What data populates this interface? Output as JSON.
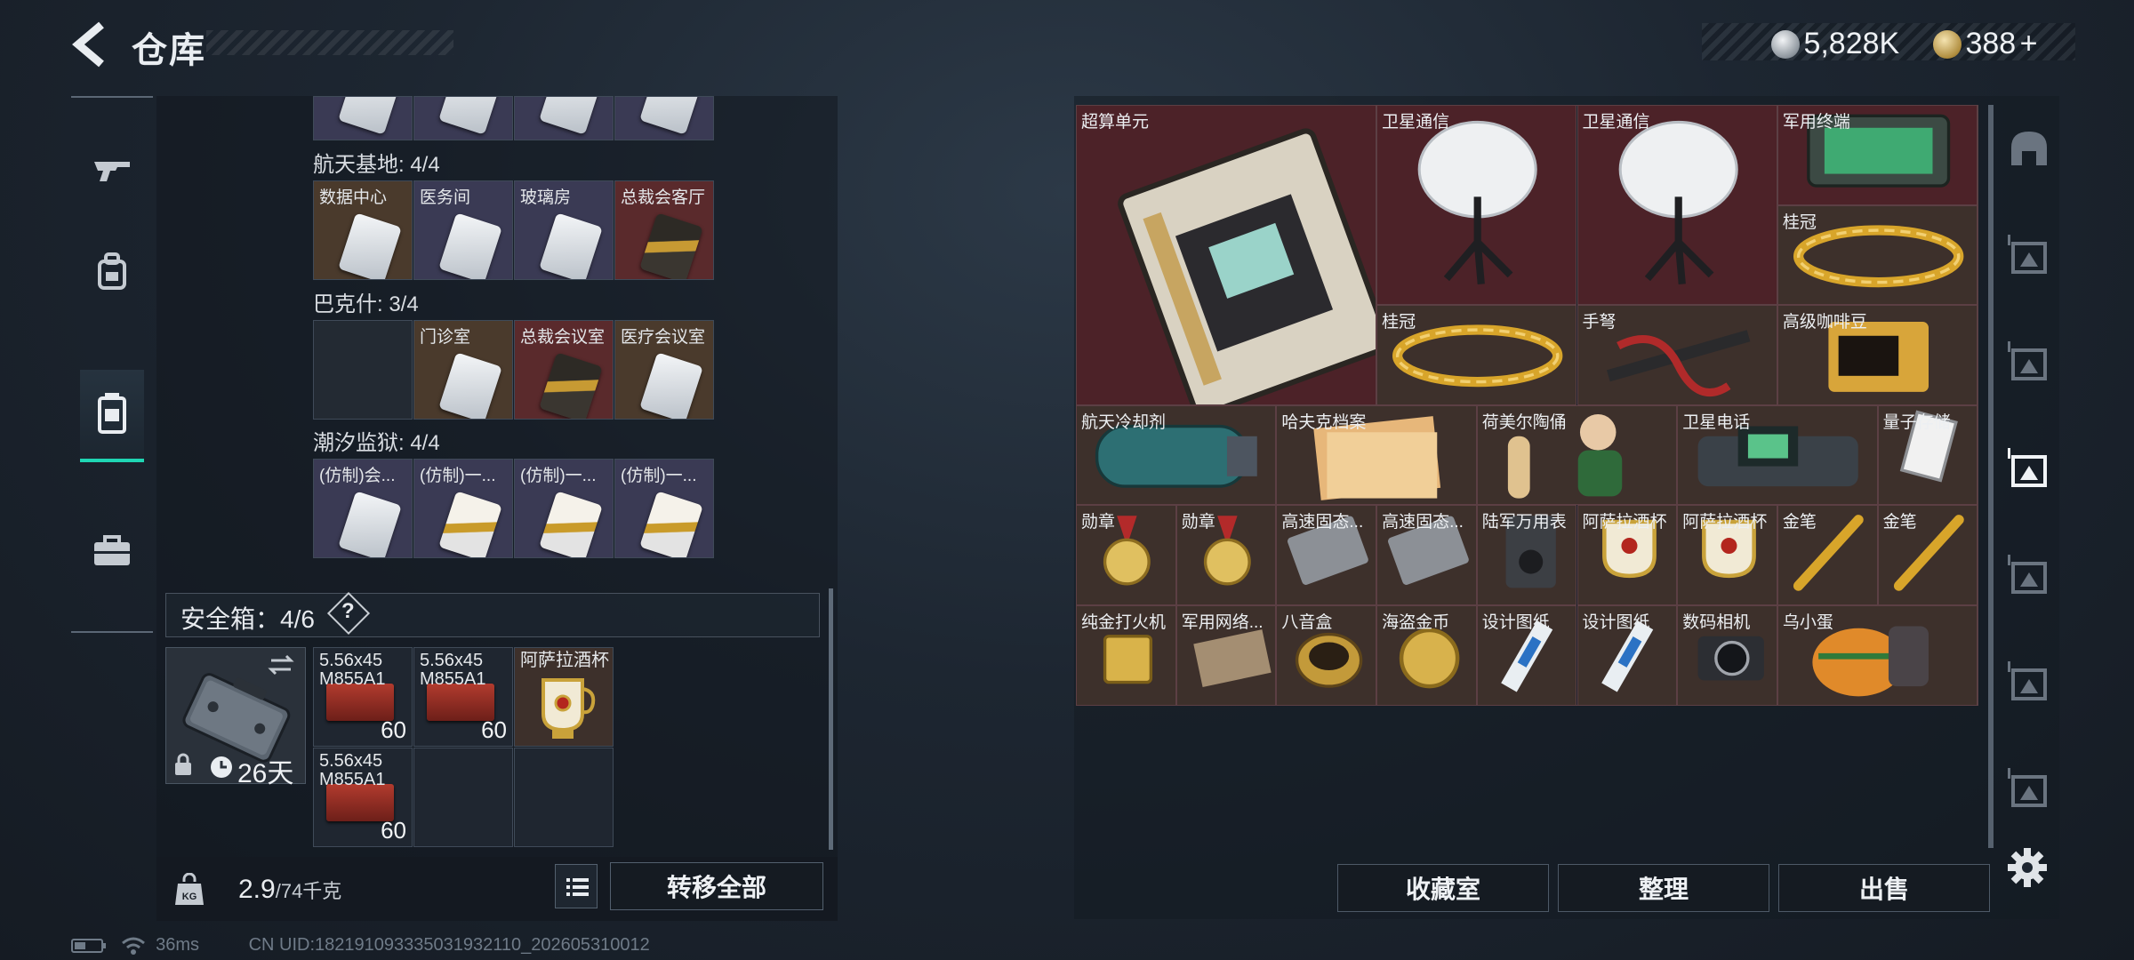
{
  "header": {
    "title": "仓库",
    "coins_label": "5,828K",
    "tokens_label": "388",
    "plus": "+"
  },
  "left_nav": {
    "tabs": [
      {
        "icon": "rifle-icon"
      },
      {
        "icon": "backpack-icon"
      },
      {
        "icon": "vest-icon"
      },
      {
        "icon": "briefcase-icon"
      }
    ],
    "active_index": 2
  },
  "keycards": {
    "sections": [
      {
        "label": "航天基地: 4/4",
        "items": [
          {
            "name": "数据中心",
            "style": "brown",
            "card": "silver"
          },
          {
            "name": "医务间",
            "style": "purple",
            "card": "silver"
          },
          {
            "name": "玻璃房",
            "style": "purple",
            "card": "silver"
          },
          {
            "name": "总裁会客厅",
            "style": "red",
            "card": "dark"
          }
        ]
      },
      {
        "label": "巴克什: 3/4",
        "items": [
          {
            "name": "",
            "style": "dark",
            "card": "none"
          },
          {
            "name": "门诊室",
            "style": "brown",
            "card": "silver"
          },
          {
            "name": "总裁会议室",
            "style": "red",
            "card": "dark"
          },
          {
            "name": "医疗会议室",
            "style": "brown",
            "card": "silver"
          }
        ]
      },
      {
        "label": "潮汐监狱: 4/4",
        "items": [
          {
            "name": "(仿制)会...",
            "style": "purple",
            "card": "silver"
          },
          {
            "name": "(仿制)一...",
            "style": "purple",
            "card": "gold"
          },
          {
            "name": "(仿制)一...",
            "style": "purple",
            "card": "gold"
          },
          {
            "name": "(仿制)一...",
            "style": "purple",
            "card": "gold"
          }
        ]
      }
    ]
  },
  "safe_box": {
    "label": "安全箱：4/6",
    "help": "?",
    "duration": "26天",
    "items": [
      {
        "name": "5.56x45\nM855A1",
        "count": "60"
      },
      {
        "name": "5.56x45\nM855A1",
        "count": "60"
      },
      {
        "name": "阿萨拉酒杯",
        "count": ""
      },
      {
        "name": "5.56x45\nM855A1",
        "count": "60"
      }
    ]
  },
  "footer_left": {
    "weight_current": "2.9",
    "weight_max": "/74千克",
    "transfer_all": "转移全部"
  },
  "status": {
    "ping": "36ms",
    "uid": "CN UID:18219109333503193​2110_202605310012"
  },
  "stash": {
    "items": [
      {
        "name": "超算单元",
        "col": 0,
        "row": 0,
        "w": 3,
        "h": 3,
        "bg": "red",
        "icon": "supercomputer-icon"
      },
      {
        "name": "卫星通信",
        "col": 3,
        "row": 0,
        "w": 2,
        "h": 2,
        "bg": "red",
        "icon": "satellite-dish-icon"
      },
      {
        "name": "卫星通信",
        "col": 5,
        "row": 0,
        "w": 2,
        "h": 2,
        "bg": "red",
        "icon": "satellite-dish-icon"
      },
      {
        "name": "军用终端",
        "col": 7,
        "row": 0,
        "w": 2,
        "h": 1,
        "bg": "red",
        "icon": "military-terminal-icon"
      },
      {
        "name": "桂冠",
        "col": 7,
        "row": 1,
        "w": 2,
        "h": 1,
        "bg": "tan",
        "icon": "laurel-crown-icon"
      },
      {
        "name": "桂冠",
        "col": 3,
        "row": 2,
        "w": 2,
        "h": 1,
        "bg": "tan",
        "icon": "laurel-crown-icon"
      },
      {
        "name": "手弩",
        "col": 5,
        "row": 2,
        "w": 2,
        "h": 1,
        "bg": "tan",
        "icon": "crossbow-icon"
      },
      {
        "name": "高级咖啡豆",
        "col": 7,
        "row": 2,
        "w": 2,
        "h": 1,
        "bg": "tan",
        "icon": "coffee-bag-icon"
      },
      {
        "name": "航天冷却剂",
        "col": 0,
        "row": 3,
        "w": 2,
        "h": 1,
        "bg": "tan",
        "icon": "coolant-tank-icon"
      },
      {
        "name": "哈夫克档案",
        "col": 2,
        "row": 3,
        "w": 2,
        "h": 1,
        "bg": "tan",
        "icon": "folder-icon"
      },
      {
        "name": "荷美尔陶俑",
        "col": 4,
        "row": 3,
        "w": 2,
        "h": 1,
        "bg": "tan",
        "icon": "figurine-icon"
      },
      {
        "name": "卫星电话",
        "col": 6,
        "row": 3,
        "w": 2,
        "h": 1,
        "bg": "tan",
        "icon": "satellite-phone-icon"
      },
      {
        "name": "量子存储",
        "col": 8,
        "row": 3,
        "w": 1,
        "h": 1,
        "bg": "tan",
        "icon": "quantum-drive-icon"
      },
      {
        "name": "勋章",
        "col": 0,
        "row": 4,
        "w": 1,
        "h": 1,
        "bg": "tan",
        "icon": "medal-icon"
      },
      {
        "name": "勋章",
        "col": 1,
        "row": 4,
        "w": 1,
        "h": 1,
        "bg": "tan",
        "icon": "medal-icon"
      },
      {
        "name": "高速固态...",
        "col": 2,
        "row": 4,
        "w": 1,
        "h": 1,
        "bg": "tan",
        "icon": "ssd-icon"
      },
      {
        "name": "高速固态...",
        "col": 3,
        "row": 4,
        "w": 1,
        "h": 1,
        "bg": "tan",
        "icon": "ssd-icon"
      },
      {
        "name": "陆军万用表",
        "col": 4,
        "row": 4,
        "w": 1,
        "h": 1,
        "bg": "tan",
        "icon": "multimeter-icon"
      },
      {
        "name": "阿萨拉酒杯",
        "col": 5,
        "row": 4,
        "w": 1,
        "h": 1,
        "bg": "tan",
        "icon": "goblet-icon"
      },
      {
        "name": "阿萨拉酒杯",
        "col": 6,
        "row": 4,
        "w": 1,
        "h": 1,
        "bg": "tan",
        "icon": "goblet-icon"
      },
      {
        "name": "金笔",
        "col": 7,
        "row": 4,
        "w": 1,
        "h": 1,
        "bg": "tan",
        "icon": "gold-pen-icon"
      },
      {
        "name": "金笔",
        "col": 8,
        "row": 4,
        "w": 1,
        "h": 1,
        "bg": "tan",
        "icon": "gold-pen-icon"
      },
      {
        "name": "纯金打火机",
        "col": 0,
        "row": 5,
        "w": 1,
        "h": 1,
        "bg": "tan",
        "icon": "lighter-icon"
      },
      {
        "name": "军用网络...",
        "col": 1,
        "row": 5,
        "w": 1,
        "h": 1,
        "bg": "tan",
        "icon": "network-device-icon"
      },
      {
        "name": "八音盒",
        "col": 2,
        "row": 5,
        "w": 1,
        "h": 1,
        "bg": "tan",
        "icon": "music-box-icon"
      },
      {
        "name": "海盗金币",
        "col": 3,
        "row": 5,
        "w": 1,
        "h": 1,
        "bg": "tan",
        "icon": "gold-coin-icon"
      },
      {
        "name": "设计图纸",
        "col": 4,
        "row": 5,
        "w": 1,
        "h": 1,
        "bg": "tan",
        "icon": "blueprint-icon"
      },
      {
        "name": "设计图纸",
        "col": 5,
        "row": 5,
        "w": 1,
        "h": 1,
        "bg": "tan",
        "icon": "blueprint-icon"
      },
      {
        "name": "数码相机",
        "col": 6,
        "row": 5,
        "w": 1,
        "h": 1,
        "bg": "tan",
        "icon": "camera-icon"
      },
      {
        "name": "乌小蛋",
        "col": 7,
        "row": 5,
        "w": 2,
        "h": 1,
        "bg": "tan",
        "icon": "egg-toy-icon"
      }
    ]
  },
  "actions": {
    "collection": "收藏室",
    "sort": "整理",
    "sell": "出售"
  },
  "right_nav": {
    "tabs": [
      {
        "icon": "helmet-icon"
      },
      {
        "icon": "stash-tab-2-icon"
      },
      {
        "icon": "stash-tab-3-icon"
      },
      {
        "icon": "stash-tab-4-icon"
      },
      {
        "icon": "stash-tab-5-icon"
      },
      {
        "icon": "stash-tab-6-icon"
      },
      {
        "icon": "stash-tab-7-icon"
      }
    ],
    "active_index": 3
  },
  "colors": {
    "accent": "#1fd6b4",
    "slot_red": "#4c2228",
    "slot_tan": "#3d302b"
  }
}
